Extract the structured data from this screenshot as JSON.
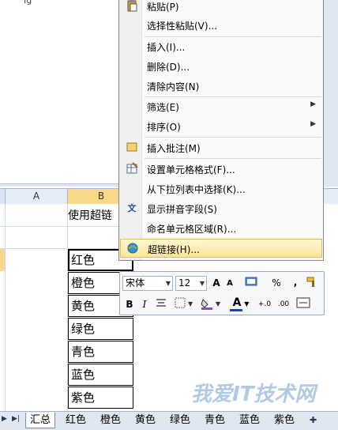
{
  "top_fragment": "Ig",
  "column_headers": [
    "A",
    "B"
  ],
  "title_cell": "使用超链",
  "color_cells": [
    "红色",
    "橙色",
    "黄色",
    "绿色",
    "青色",
    "蓝色",
    "紫色"
  ],
  "context_menu": {
    "items": [
      {
        "label": "粘贴(P)",
        "icon": "paste-icon"
      },
      {
        "label": "选择性粘贴(V)...",
        "icon": ""
      },
      {
        "label": "插入(I)...",
        "icon": ""
      },
      {
        "label": "删除(D)...",
        "icon": ""
      },
      {
        "label": "清除内容(N)",
        "icon": ""
      },
      {
        "label": "筛选(E)",
        "icon": "",
        "submenu": true
      },
      {
        "label": "排序(O)",
        "icon": "",
        "submenu": true
      },
      {
        "label": "插入批注(M)",
        "icon": "comment-icon"
      },
      {
        "label": "设置单元格格式(F)...",
        "icon": "format-cells-icon"
      },
      {
        "label": "从下拉列表中选择(K)...",
        "icon": ""
      },
      {
        "label": "显示拼音字段(S)",
        "icon": "phonetic-icon"
      },
      {
        "label": "命名单元格区域(R)...",
        "icon": ""
      },
      {
        "label": "超链接(H)...",
        "icon": "hyperlink-icon",
        "highlighted": true
      }
    ]
  },
  "mini_toolbar": {
    "font_name": "宋体",
    "font_size": "12",
    "grow_font": "A",
    "shrink_font": "A",
    "percent": "%",
    "comma": ",",
    "bold": "B",
    "italic": "I",
    "font_color": "A",
    "inc_decimal": "+.0",
    "dec_decimal": ".00"
  },
  "sheet_tabs": [
    "汇总",
    "红色",
    "橙色",
    "黄色",
    "绿色",
    "青色",
    "蓝色",
    "紫色"
  ],
  "active_tab": "汇总",
  "watermark": {
    "main": "我爱IT技术网",
    "sub": ""
  },
  "colors": {
    "accent_selected": "#f8d98a",
    "menu_highlight": "#fde5a0",
    "font_color_bar": "#1f3fbf"
  }
}
